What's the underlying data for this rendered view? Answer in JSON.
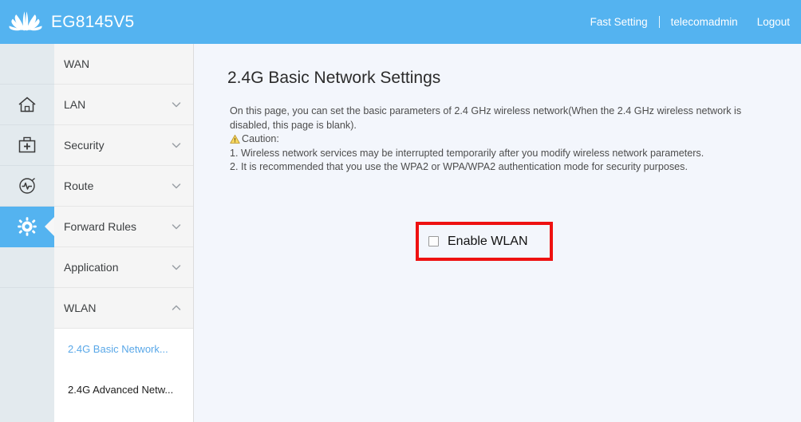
{
  "header": {
    "brand": "EG8145V5",
    "logo_icon": "huawei-flower-logo",
    "fast_setting": "Fast Setting",
    "user": "telecomadmin",
    "logout": "Logout",
    "bg_color": "#54b3f0"
  },
  "rail": {
    "items": [
      {
        "icon": "blank-icon",
        "name": "rail-item-blank",
        "active": false
      },
      {
        "icon": "home-icon",
        "name": "rail-item-home",
        "active": false
      },
      {
        "icon": "toolbox-icon",
        "name": "rail-item-toolbox",
        "active": false
      },
      {
        "icon": "diagnostics-icon",
        "name": "rail-item-diagnostics",
        "active": false
      },
      {
        "icon": "gear-icon",
        "name": "rail-item-settings",
        "active": true
      }
    ],
    "active_color": "#54b3f0"
  },
  "menu": {
    "items": [
      {
        "label": "WAN",
        "chevron": "none"
      },
      {
        "label": "LAN",
        "chevron": "chevron-down-icon"
      },
      {
        "label": "Security",
        "chevron": "chevron-down-icon"
      },
      {
        "label": "Route",
        "chevron": "chevron-down-icon"
      },
      {
        "label": "Forward Rules",
        "chevron": "chevron-down-icon"
      },
      {
        "label": "Application",
        "chevron": "chevron-down-icon"
      },
      {
        "label": "WLAN",
        "chevron": "chevron-up-icon"
      }
    ],
    "submenu": [
      {
        "label": "2.4G Basic Network...",
        "active": true
      },
      {
        "label": "2.4G Advanced Netw...",
        "active": false
      }
    ],
    "active_color": "#5aa8e8"
  },
  "content": {
    "title": "2.4G Basic Network Settings",
    "description_line1": "On this page, you can set the basic parameters of 2.4 GHz wireless network(When the 2.4 GHz wireless network is",
    "description_line2": "disabled, this page is blank).",
    "caution_label": "Caution:",
    "caution_icon": "warning-triangle-icon",
    "caution_1": "1. Wireless network services may be interrupted temporarily after you modify wireless network parameters.",
    "caution_2": "2. It is recommended that you use the WPA2 or WPA/WPA2 authentication mode for security purposes.",
    "enable_wlan_label": "Enable WLAN",
    "enable_wlan_checked": false,
    "highlight_color": "#ee1111",
    "background_color": "#f3f6fc"
  }
}
